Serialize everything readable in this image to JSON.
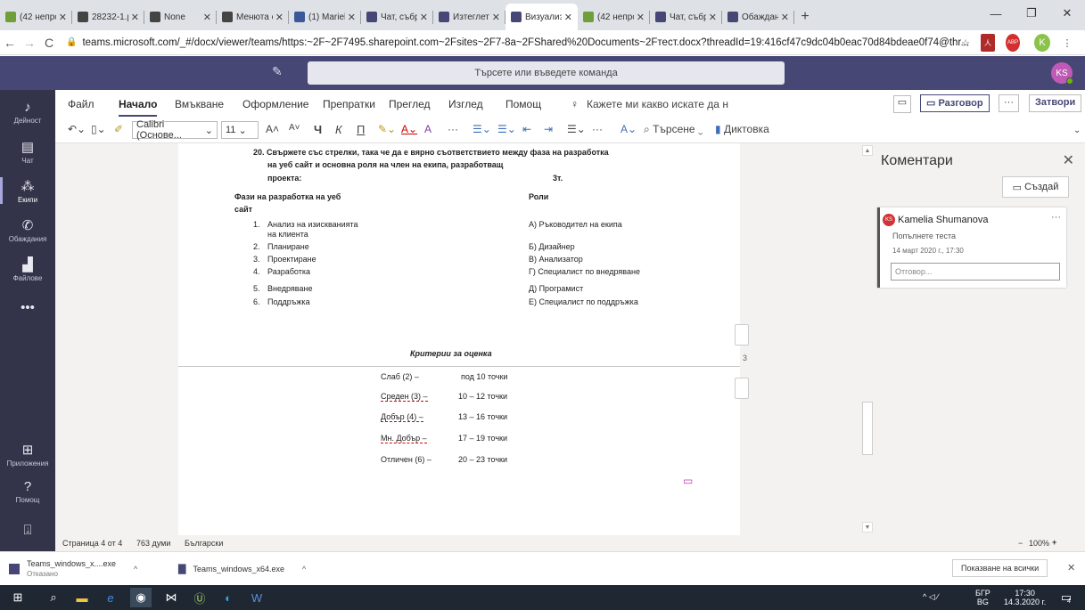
{
  "browser": {
    "tabs": [
      {
        "title": "(42 непро",
        "color": "#6f9e3a"
      },
      {
        "title": "28232-1.p",
        "color": "#444"
      },
      {
        "title": "None",
        "color": "#444"
      },
      {
        "title": "Менюта с",
        "color": "#444"
      },
      {
        "title": "(1) Mariela",
        "color": "#3b5998"
      },
      {
        "title": "Чат, събр",
        "color": "#464775"
      },
      {
        "title": "Изтеглете",
        "color": "#464775"
      },
      {
        "title": "Визуализ",
        "color": "#464775",
        "active": true
      },
      {
        "title": "(42 непро",
        "color": "#6f9e3a"
      },
      {
        "title": "Чат, събр",
        "color": "#464775"
      },
      {
        "title": "Обаждане",
        "color": "#464775"
      }
    ],
    "new_tab": "+",
    "url": "teams.microsoft.com/_#/docx/viewer/teams/https:~2F~2F7495.sharepoint.com~2Fsites~2F7-8a~2FShared%20Documents~2Fтест.docx?threadId=19:416cf47c9dc04b0eac70d84bdeae0f74@thr...",
    "profile_initial": "K"
  },
  "teams": {
    "search_placeholder": "Търсете или въведете команда",
    "avatar_initials": "KS",
    "rail": [
      {
        "label": "Дейност",
        "icon": "♪"
      },
      {
        "label": "Чат",
        "icon": "▤"
      },
      {
        "label": "Екипи",
        "icon": "⁂",
        "active": true
      },
      {
        "label": "Обаждания",
        "icon": "✆"
      },
      {
        "label": "Файлове",
        "icon": "▟"
      },
      {
        "label": "",
        "icon": "•••"
      }
    ],
    "rail_bottom": [
      {
        "label": "Приложения",
        "icon": "⊞"
      },
      {
        "label": "Помощ",
        "icon": "?"
      }
    ]
  },
  "word": {
    "menu": [
      "Файл",
      "Начало",
      "Вмъкване",
      "Оформление",
      "Препратки",
      "Преглед",
      "Изглед",
      "Помощ"
    ],
    "tell_me": "Кажете ми какво искате да н",
    "conversation": "Разговор",
    "close": "Затвори",
    "font_name": "Calibri (Основе...",
    "font_size": "11",
    "find": "Търсене",
    "dictate": "Диктовка",
    "ribbon_bold": "Ч",
    "ribbon_italic": "К",
    "ribbon_underline": "П"
  },
  "document": {
    "q_line1": "20.  Свържете със стрелки, така че да е вярно съответствието между фаза на разработка",
    "q_line2": "на уеб сайт и основна роля на член на екипа, разработващ",
    "q_line3": "проекта:",
    "points": "3т.",
    "col1_head1": "Фази на разработка на уеб",
    "col1_head2": "сайт",
    "col2_head": "Роли",
    "phases": [
      "Анализ на изискванията",
      "Планиране",
      "Проектиране",
      "Разработка",
      "Внедряване",
      "Поддръжка"
    ],
    "phase1_cont": "на клиента",
    "roles": [
      "А) Ръководител на екипа",
      "Б) Дизайнер",
      "В) Анализатор",
      "Г) Специалист по внедряване",
      "Д) Програмист",
      "Е) Специалист по поддръжка"
    ],
    "criteria_title": "Критерии за оценка",
    "grades": [
      {
        "label": "Слаб (2) –",
        "range": "под 10 точки"
      },
      {
        "label": "Среден (3) –",
        "range": "10  –  12 точки"
      },
      {
        "label": "Добър (4) –",
        "range": "13  –  16 точки"
      },
      {
        "label": "Мн. Добър –",
        "range": "17  –  19 точки"
      },
      {
        "label": "Отличен (6) –",
        "range": "20  –  23 точки"
      }
    ],
    "margin_num": "3"
  },
  "comments": {
    "title": "Коментари",
    "create": "Създай",
    "item": {
      "initials": "KS",
      "author": "Kamelia Shumanova",
      "text": "Попълнете теста",
      "date": "14 март 2020 г., 17:30",
      "reply_placeholder": "Отговор..."
    }
  },
  "status": {
    "page": "Страница 4 от 4",
    "words": "763 думи",
    "language": "Български",
    "zoom": "100%"
  },
  "downloads": {
    "item1_name": "Teams_windows_x....exe",
    "item1_status": "Отказано",
    "item2_name": "Teams_windows_x64.exe",
    "show_all": "Показване на всички"
  },
  "taskbar": {
    "lang": "БГР",
    "lang2": "BG",
    "time": "17:30",
    "date": "14.3.2020 г.",
    "notif_count": "4"
  }
}
